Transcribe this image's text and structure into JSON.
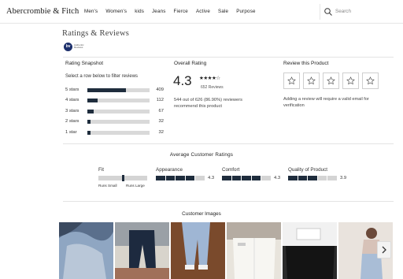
{
  "header": {
    "brand": "Abercrombie & Fitch",
    "nav": [
      "Men's",
      "Women's",
      "kids",
      "Jeans",
      "Fierce",
      "Active",
      "Sale",
      "Purpose"
    ],
    "search_placeholder": "Search"
  },
  "ratings": {
    "title": "Ratings & Reviews",
    "badge_initials": "bv",
    "badge_text_1": "Authentic",
    "badge_text_2": "Reviews"
  },
  "snapshot": {
    "heading": "Rating Snapshot",
    "subheading": "Select a row below to filter reviews",
    "rows": [
      {
        "label": "5 stars",
        "count": "409",
        "fraction": 0.62
      },
      {
        "label": "4 stars",
        "count": "112",
        "fraction": 0.17
      },
      {
        "label": "3 stars",
        "count": "67",
        "fraction": 0.1
      },
      {
        "label": "2 stars",
        "count": "32",
        "fraction": 0.05
      },
      {
        "label": "1 star",
        "count": "32",
        "fraction": 0.05
      }
    ]
  },
  "overall": {
    "heading": "Overall Rating",
    "score": "4.3",
    "stars": "★★★★☆",
    "reviews": "652 Reviews",
    "recommend": "544 out of 626 (86.90%) reviewers recommend this product"
  },
  "review_product": {
    "heading": "Review this Product",
    "note": "Adding a review will require a valid email for verification"
  },
  "average": {
    "title": "Average Customer Ratings",
    "fit_label": "Fit",
    "fit_left": "Runs Small",
    "fit_right": "Runs Large",
    "fit_position": 0.5,
    "appearance_label": "Appearance",
    "appearance_value": "4.3",
    "comfort_label": "Comfort",
    "comfort_value": "4.3",
    "quality_label": "Quality of Product",
    "quality_value": "3.9"
  },
  "images": {
    "title": "Customer Images"
  },
  "colors": {
    "accent": "#1f2d3d",
    "track": "#d9d9d9"
  }
}
